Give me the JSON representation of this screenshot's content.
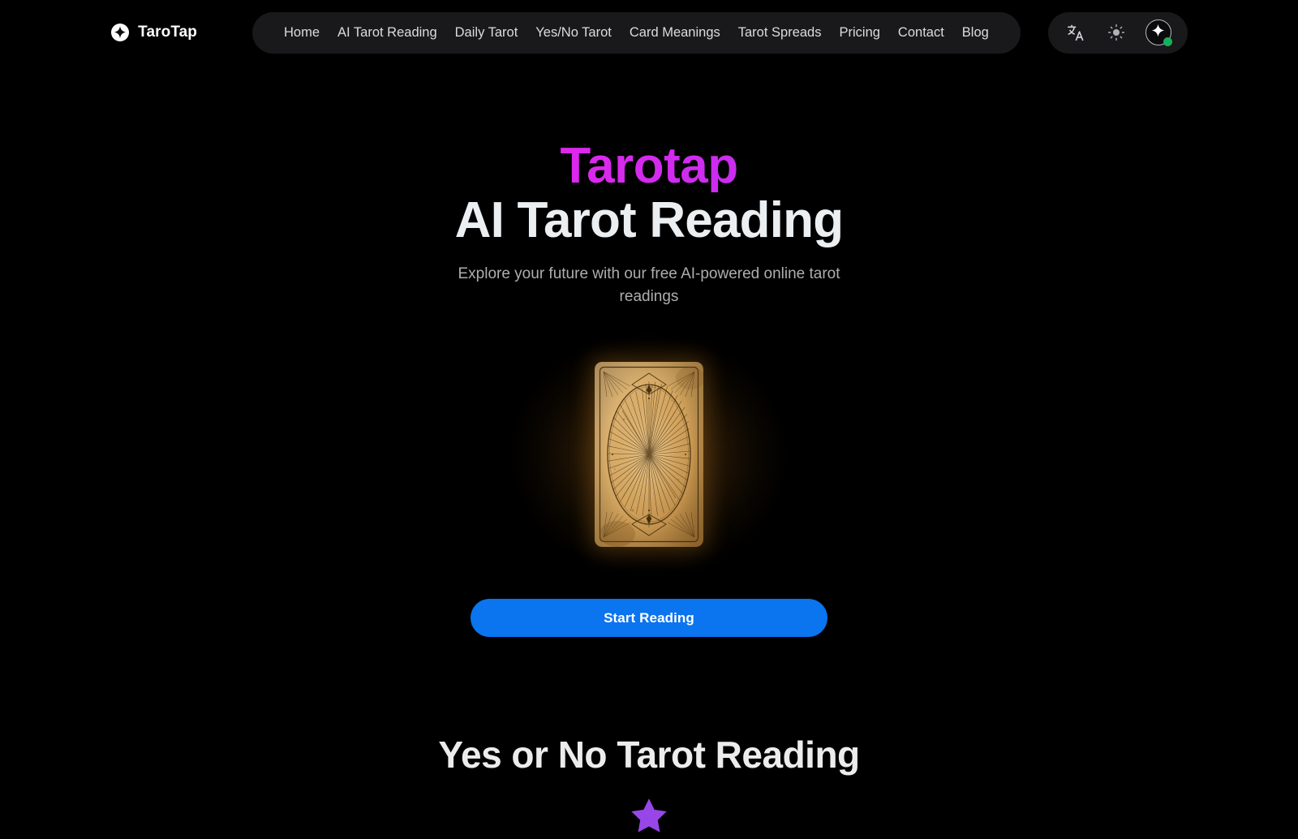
{
  "header": {
    "brand": {
      "name": "TaroTap",
      "logo_icon": "sparkle-circle-icon"
    },
    "nav": [
      {
        "label": "Home"
      },
      {
        "label": "AI Tarot Reading"
      },
      {
        "label": "Daily Tarot"
      },
      {
        "label": "Yes/No Tarot"
      },
      {
        "label": "Card Meanings"
      },
      {
        "label": "Tarot Spreads"
      },
      {
        "label": "Pricing"
      },
      {
        "label": "Contact"
      },
      {
        "label": "Blog"
      }
    ],
    "utilities": {
      "language_icon": "translate-icon",
      "theme_icon": "sun-icon",
      "avatar_icon": "sparkle-icon",
      "status": "online"
    }
  },
  "hero": {
    "brand_word": "Tarotap",
    "title": "AI Tarot Reading",
    "subtitle": "Explore your future with our free AI-powered online tarot readings",
    "card_alt": "tarot-card-back",
    "cta_label": "Start Reading"
  },
  "section_two": {
    "title": "Yes or No Tarot Reading",
    "star_icon": "star-icon"
  },
  "colors": {
    "page_background": "#000000",
    "pill_background": "#19191b",
    "brand_gradient_start": "#ff1ae0",
    "brand_gradient_end": "#a63df5",
    "cta_blue": "#0b74ef",
    "status_green": "#16b05a",
    "star_purple": "#9747e8",
    "card_parchment": "#d8a855",
    "heading_white": "#eceff1",
    "body_gray": "#aeaeae"
  }
}
